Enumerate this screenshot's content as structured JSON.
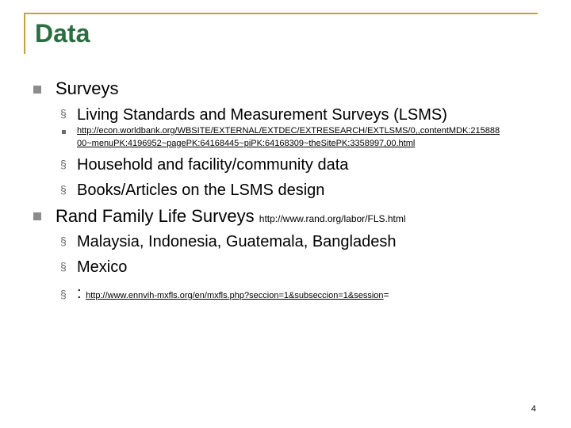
{
  "slide": {
    "title": "Data",
    "page_number": "4",
    "colors": {
      "frame": "#c4a23a",
      "title": "#2a6e40",
      "bullet": "#8c8c8c"
    }
  },
  "bullets": {
    "surveys": "Surveys",
    "lsms": "Living Standards and Measurement Surveys (LSMS)",
    "lsms_url_line1": "http://econ.worldbank.org/WBSITE/EXTERNAL/EXTDEC/EXTRESEARCH/EXTLSMS/0,,contentMDK:215888",
    "lsms_url_line2": "00~menuPK:4196952~pagePK:64168445~piPK:64168309~theSitePK:3358997,00.html",
    "household": "Household and facility/community data",
    "books": "Books/Articles on the LSMS design",
    "rand": "Rand Family Life Surveys",
    "rand_url": "http://www.rand.org/labor/FLS.html",
    "countries": "Malaysia, Indonesia, Guatemala, Bangladesh",
    "mexico": "Mexico",
    "colon": ":",
    "mexico_url": "http://www.ennvih-mxfls.org/en/mxfls.php?seccion=1&subseccion=1&session",
    "mexico_url_tail": "="
  }
}
